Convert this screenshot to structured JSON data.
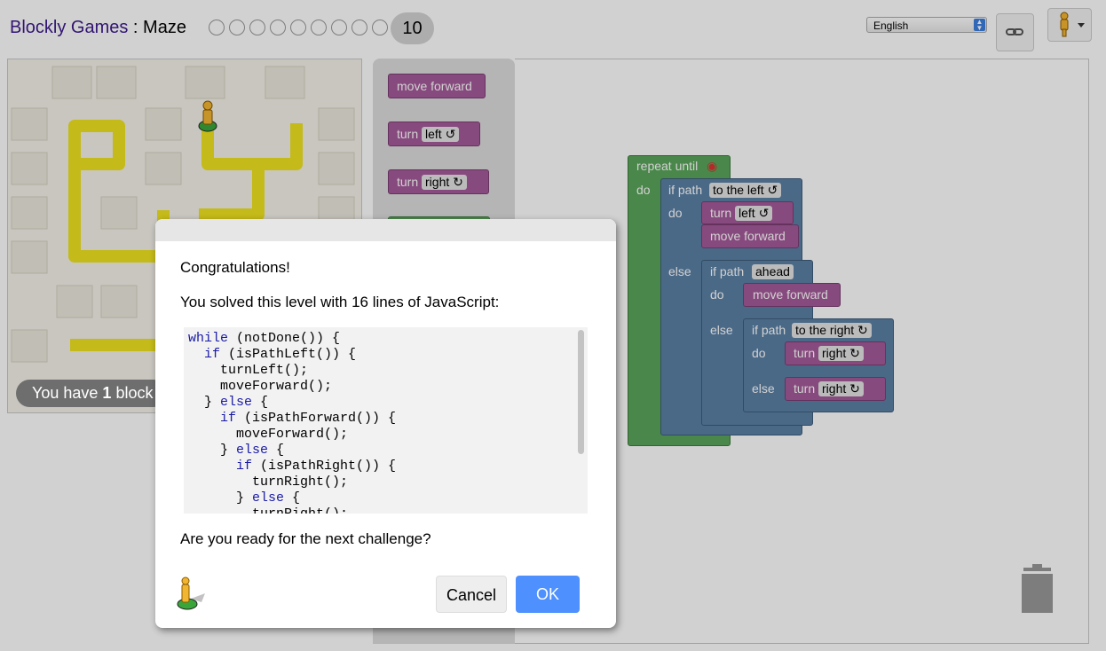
{
  "header": {
    "app_name": "Blockly Games",
    "separator": " : ",
    "game_name": "Maze",
    "current_level": "10",
    "language": "English"
  },
  "maze": {
    "banner_prefix": "You have ",
    "banner_count": "1",
    "banner_suffix": " block"
  },
  "toolbox": {
    "move_forward": "move forward",
    "turn_left_label": "turn",
    "turn_left_dir": "left ↺",
    "turn_right_label": "turn",
    "turn_right_dir": "right ↻"
  },
  "workspace": {
    "repeat_until": "repeat until",
    "do": "do",
    "else": "else",
    "if_path": "if path",
    "to_the_left": "to the left ↺",
    "ahead": "ahead",
    "to_the_right": "to the right ↻",
    "turn": "turn",
    "left": "left ↺",
    "right": "right ↻",
    "move_forward": "move forward"
  },
  "dialog": {
    "title": "Congratulations!",
    "message": "You solved this level with 16 lines of JavaScript:",
    "code_lines": [
      "while (notDone()) {",
      "  if (isPathLeft()) {",
      "    turnLeft();",
      "    moveForward();",
      "  } else {",
      "    if (isPathForward()) {",
      "      moveForward();",
      "    } else {",
      "      if (isPathRight()) {",
      "        turnRight();",
      "      } else {",
      "        turnRight();"
    ],
    "question": "Are you ready for the next challenge?",
    "cancel_label": "Cancel",
    "ok_label": "OK"
  },
  "colors": {
    "accent": "#4d90fe",
    "brand": "#3c1a8c",
    "path_yellow": "#f0e31f"
  }
}
